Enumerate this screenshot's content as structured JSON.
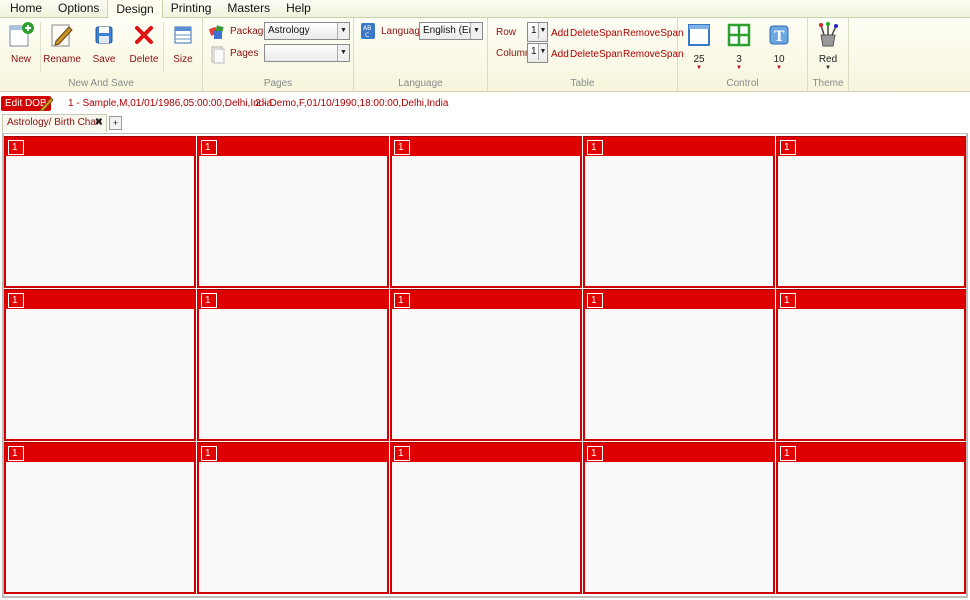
{
  "menu": {
    "tabs": [
      "Home",
      "Options",
      "Design",
      "Printing",
      "Masters",
      "Help"
    ],
    "active": "Design"
  },
  "ribbon": {
    "new_and_save": {
      "label": "New And Save",
      "new": "New",
      "rename": "Rename",
      "save": "Save",
      "delete": "Delete",
      "size": "Size"
    },
    "pages": {
      "label": "Pages",
      "package_label": "Package",
      "package_value": "Astrology",
      "pages_label": "Pages",
      "pages_value": ""
    },
    "language": {
      "label": "Language",
      "language_label": "Language",
      "language_value": "English (Eng"
    },
    "table": {
      "label": "Table",
      "row_label": "Row",
      "row_value": "1",
      "column_label": "Column",
      "column_value": "1",
      "add": "Add",
      "delete": "Delete",
      "span": "Span",
      "remove_span": "RemoveSpan"
    },
    "control": {
      "label": "Control",
      "window_value": "25",
      "grid_value": "3",
      "text_value": "10"
    },
    "theme": {
      "label": "Theme",
      "value": "Red"
    }
  },
  "dob": {
    "edit_button": "Edit DOB",
    "entry1": "1 - Sample,M,01/01/1986,05:00:00,Delhi,India",
    "entry2": "2 - Demo,F,01/10/1990,18:00:00,Delhi,India"
  },
  "document": {
    "tab_label": "Astrology/ Birth Chart",
    "close_symbol": "✖",
    "add_tab_symbol": "+"
  },
  "chart_grid": {
    "rows": 3,
    "columns": 5,
    "cell_badges": [
      "1",
      "1",
      "1",
      "1",
      "1",
      "1",
      "1",
      "1",
      "1",
      "1",
      "1",
      "1",
      "1",
      "1",
      "1"
    ]
  },
  "colors": {
    "accent_red": "#de0000",
    "ribbon_bg": "#f6f5dc",
    "text_red": "#b00000"
  }
}
